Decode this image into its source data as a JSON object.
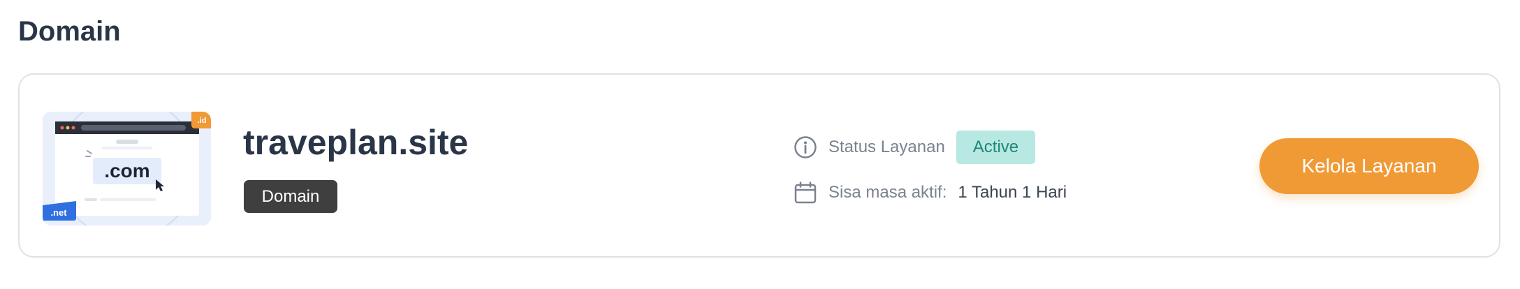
{
  "page": {
    "title": "Domain"
  },
  "service": {
    "domain_name": "traveplan.site",
    "type_tag": "Domain",
    "illustration": {
      "main_label": ".com",
      "badge_top_right": ".id",
      "badge_bottom_left": ".net"
    },
    "status_label": "Status Layanan",
    "status_value": "Active",
    "expiry_label": "Sisa masa aktif:",
    "expiry_value": "1 Tahun 1 Hari",
    "manage_button_label": "Kelola Layanan"
  },
  "icons": {
    "status": "info-circle-icon",
    "expiry": "calendar-icon"
  },
  "colors": {
    "title": "#2a3648",
    "tag_background": "#3f3f3f",
    "status_badge_background": "#b8e8e2",
    "status_badge_text": "#1f8577",
    "button_background": "#f09a36",
    "id_badge": "#f09a36",
    "net_badge": "#2f6fe0",
    "card_border": "#dfe1e6"
  }
}
